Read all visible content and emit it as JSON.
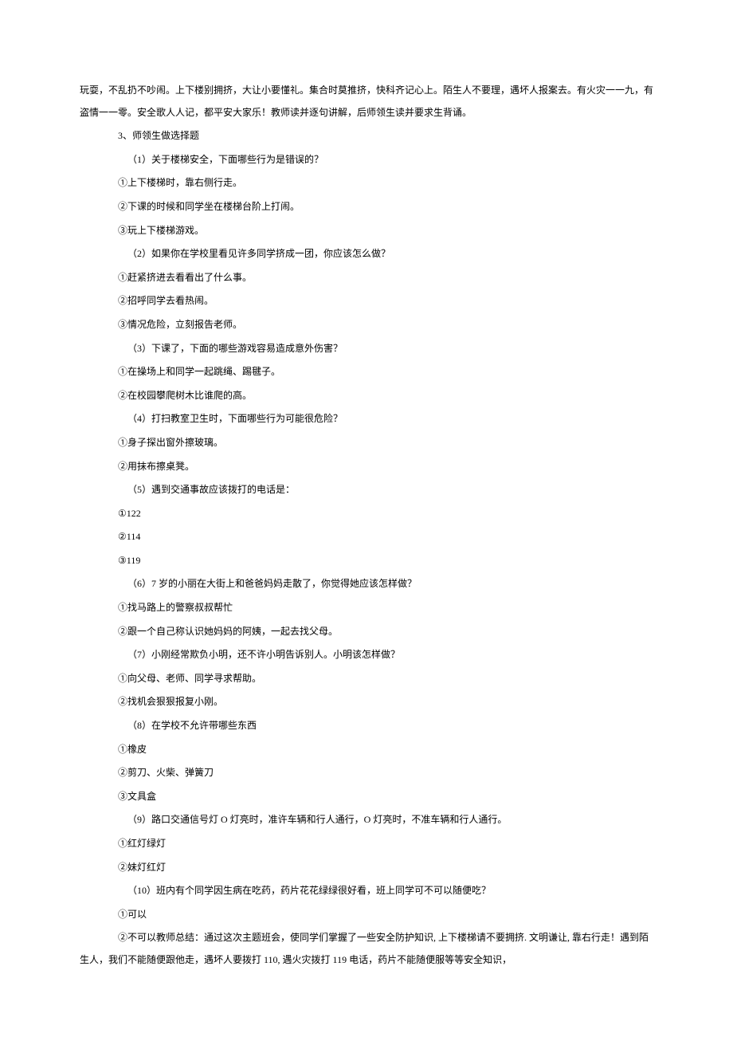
{
  "intro": "玩耍，不乱扔不吵闹。上下楼别拥挤，大让小要懂礼。集合时莫推挤，快科齐记心上。陌生人不要理，遇坏人报案去。有火灾一一九，有盗情一一零。安全歌人人记，都平安大家乐！教师读并逐句讲解，后师领生读并要求生背诵。",
  "section3": "3、师领生做选择题",
  "q1": {
    "stem": "（1）关于楼梯安全，下面哪些行为是错误的？",
    "opt1": "①上下楼梯时，靠右侧行走。",
    "opt2": "②下课的时候和同学坐在楼梯台阶上打闹。",
    "opt3": "③玩上下楼梯游戏。"
  },
  "q2": {
    "stem": "（2）如果你在学校里看见许多同学挤成一团，你应该怎么做？",
    "opt1": "①赶紧挤进去看看出了什么事。",
    "opt2": "②招呼同学去看热闹。",
    "opt3": "③情况危险，立刻报告老师。"
  },
  "q3": {
    "stem": "（3）下课了，下面的哪些游戏容易造成意外伤害？",
    "opt1": "①在操场上和同学一起跳绳、踢毽子。",
    "opt2": "②在校园攀爬树木比谁爬的高。"
  },
  "q4": {
    "stem": "（4）打扫教室卫生时，下面哪些行为可能很危险？",
    "opt1": "①身子探出窗外擦玻璃。",
    "opt2": "②用抹布擦桌凳。"
  },
  "q5": {
    "stem": "（5）遇到交通事故应该拨打的电话是：",
    "opt1": "①122",
    "opt2": "②114",
    "opt3": "③119"
  },
  "q6": {
    "stem": "（6）7 岁的小丽在大街上和爸爸妈妈走散了，你觉得她应该怎样做？",
    "opt1": "①找马路上的警察叔叔帮忙",
    "opt2": "②跟一个自己称认识她妈妈的阿姨，一起去找父母。"
  },
  "q7": {
    "stem": "（7）小刚经常欺负小明，还不许小明告诉别人。小明该怎样做？",
    "opt1": "①向父母、老师、同学寻求帮助。",
    "opt2": "②找机会狠狠报复小刚。"
  },
  "q8": {
    "stem": "（8）在学校不允许带哪些东西",
    "opt1": "①橡皮",
    "opt2": "②剪刀、火柴、弹簧刀",
    "opt3": "③文具盒"
  },
  "q9": {
    "stem": "（9）路口交通信号灯 O 灯亮时，准许车辆和行人通行，O 灯亮时，不准车辆和行人通行。",
    "opt1": "①红灯绿灯",
    "opt2": "②妹灯红灯"
  },
  "q10": {
    "stem": "（10）班内有个同学因生病在吃药，药片花花绿绿很好看，班上同学可不可以随便吃？",
    "opt1": "①可以",
    "opt2": "②不可以教师总结：通过这次主题班会，使同学们掌握了一些安全防护知识, 上下楼梯请不要拥挤. 文明谦让, 靠右行走！遇到陌生人，我们不能随便跟他走，遇坏人要拨打 110, 遇火灾拨打 119 电话，药片不能随便服等等安全知识，"
  }
}
